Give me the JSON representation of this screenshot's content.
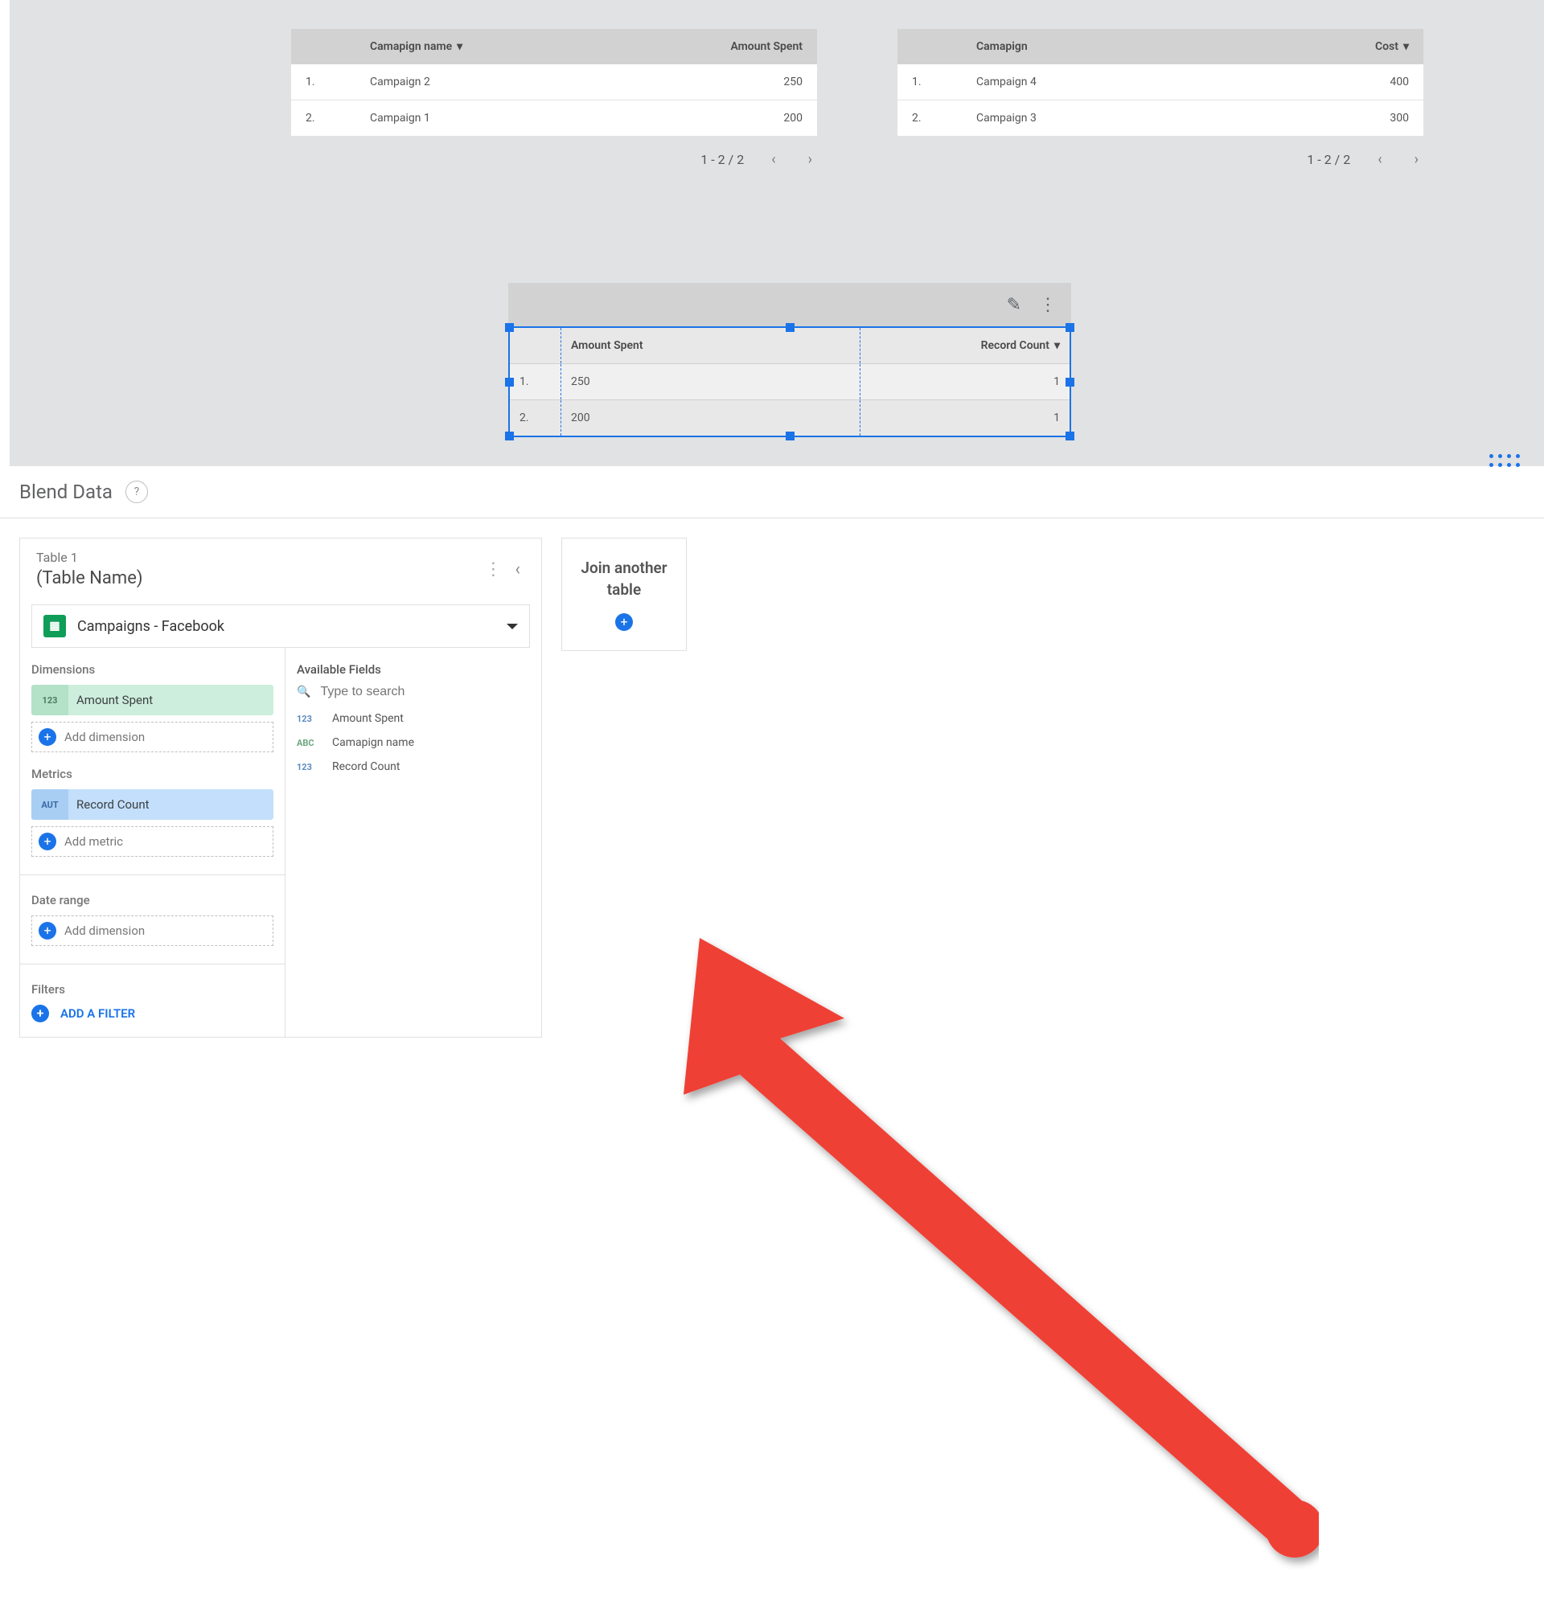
{
  "tables": {
    "left": {
      "col1": "Camapign name",
      "col2": "Amount Spent",
      "rows": [
        {
          "idx": "1.",
          "c1": "Campaign 2",
          "c2": "250"
        },
        {
          "idx": "2.",
          "c1": "Campaign 1",
          "c2": "200"
        }
      ],
      "pager": "1 - 2 / 2"
    },
    "right": {
      "col1": "Camapign",
      "col2": "Cost",
      "rows": [
        {
          "idx": "1.",
          "c1": "Campaign 4",
          "c2": "400"
        },
        {
          "idx": "2.",
          "c1": "Campaign 3",
          "c2": "300"
        }
      ],
      "pager": "1 - 2 / 2"
    },
    "selected": {
      "col1": "Amount Spent",
      "col2": "Record Count",
      "rows": [
        {
          "idx": "1.",
          "c1": "250",
          "c2": "1"
        },
        {
          "idx": "2.",
          "c1": "200",
          "c2": "1"
        }
      ]
    }
  },
  "blend": {
    "title": "Blend Data",
    "table_label": "Table 1",
    "table_name": "(Table Name)",
    "datasource": "Campaigns - Facebook",
    "dimensions_label": "Dimensions",
    "dim_pill_type": "123",
    "dim_pill_name": "Amount Spent",
    "add_dimension": "Add dimension",
    "metrics_label": "Metrics",
    "met_pill_type": "AUT",
    "met_pill_name": "Record Count",
    "add_metric": "Add metric",
    "daterange_label": "Date range",
    "filters_label": "Filters",
    "add_filter": "ADD A FILTER",
    "available_label": "Available Fields",
    "search_placeholder": "Type to search",
    "fields": [
      {
        "t": "123",
        "cls": "num",
        "n": "Amount Spent"
      },
      {
        "t": "ABC",
        "cls": "txt",
        "n": "Camapign name"
      },
      {
        "t": "123",
        "cls": "num",
        "n": "Record Count"
      }
    ],
    "join_label": "Join another table"
  }
}
